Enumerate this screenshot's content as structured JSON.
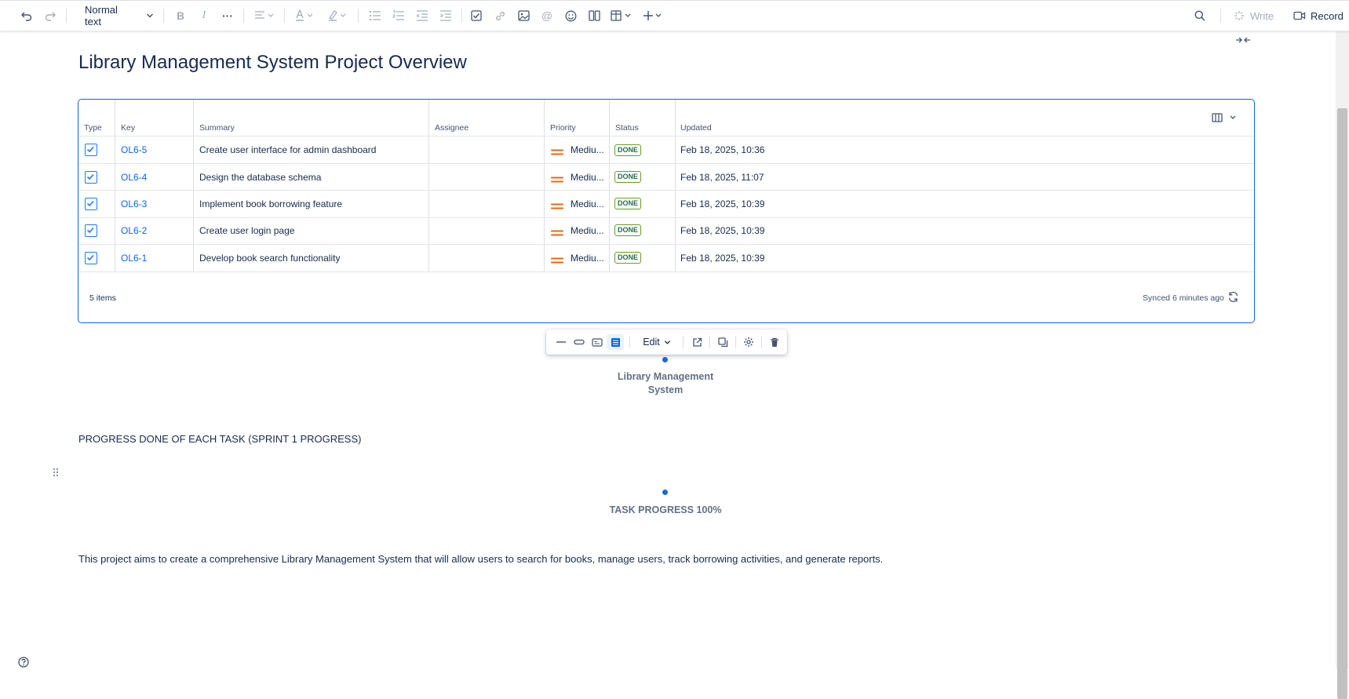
{
  "toolbar": {
    "text_style": "Normal text",
    "write_label": "Write",
    "record_label": "Record"
  },
  "page": {
    "title": "Library Management System Project Overview"
  },
  "jira_table": {
    "columns": [
      "Type",
      "Key",
      "Summary",
      "Assignee",
      "Priority",
      "Status",
      "Updated"
    ],
    "rows": [
      {
        "key": "OL6-5",
        "summary": "Create user interface for admin dashboard",
        "assignee": "",
        "priority": "Mediu...",
        "status": "DONE",
        "updated": "Feb 18, 2025, 10:36"
      },
      {
        "key": "OL6-4",
        "summary": "Design the database schema",
        "assignee": "",
        "priority": "Mediu...",
        "status": "DONE",
        "updated": "Feb 18, 2025, 11:07"
      },
      {
        "key": "OL6-3",
        "summary": "Implement book borrowing feature",
        "assignee": "",
        "priority": "Mediu...",
        "status": "DONE",
        "updated": "Feb 18, 2025, 10:39"
      },
      {
        "key": "OL6-2",
        "summary": "Create user login page",
        "assignee": "",
        "priority": "Mediu...",
        "status": "DONE",
        "updated": "Feb 18, 2025, 10:39"
      },
      {
        "key": "OL6-1",
        "summary": "Develop book search functionality",
        "assignee": "",
        "priority": "Mediu...",
        "status": "DONE",
        "updated": "Feb 18, 2025, 10:39"
      }
    ],
    "footer_count": "5 items",
    "footer_sync": "Synced 6 minutes ago"
  },
  "floating_toolbar": {
    "edit_label": "Edit"
  },
  "chart_placeholder_1": {
    "caption_line1": "Library Management",
    "caption_line2": "System"
  },
  "section": {
    "heading": "PROGRESS DONE OF EACH TASK (SPRINT 1 PROGRESS)"
  },
  "chart_placeholder_2": {
    "caption": "TASK PROGRESS 100%"
  },
  "description": "This project aims to create a comprehensive Library Management System that will allow users to search for books, manage users, track borrowing activities, and generate reports.",
  "colors": {
    "accent": "#0c66e4",
    "priority_medium": "#e56910",
    "done_border": "#6a9a23",
    "dot": "#1868db"
  }
}
